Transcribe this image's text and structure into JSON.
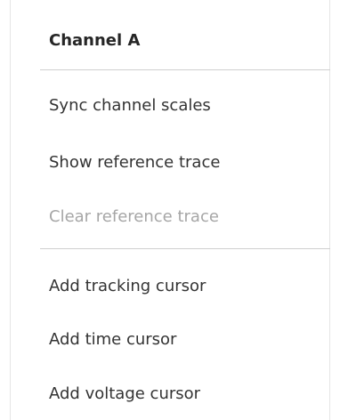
{
  "menu": {
    "header": "Channel A",
    "items": [
      {
        "label": "Sync channel scales",
        "enabled": true
      },
      {
        "label": "Show reference trace",
        "enabled": true
      },
      {
        "label": "Clear reference trace",
        "enabled": false
      },
      {
        "label": "Add tracking cursor",
        "enabled": true
      },
      {
        "label": "Add time cursor",
        "enabled": true
      },
      {
        "label": "Add voltage cursor",
        "enabled": true
      }
    ]
  },
  "colors": {
    "text": "#333333",
    "disabled_text": "#a6a6a6",
    "separator": "#cfcfcf",
    "background": "#ffffff"
  }
}
